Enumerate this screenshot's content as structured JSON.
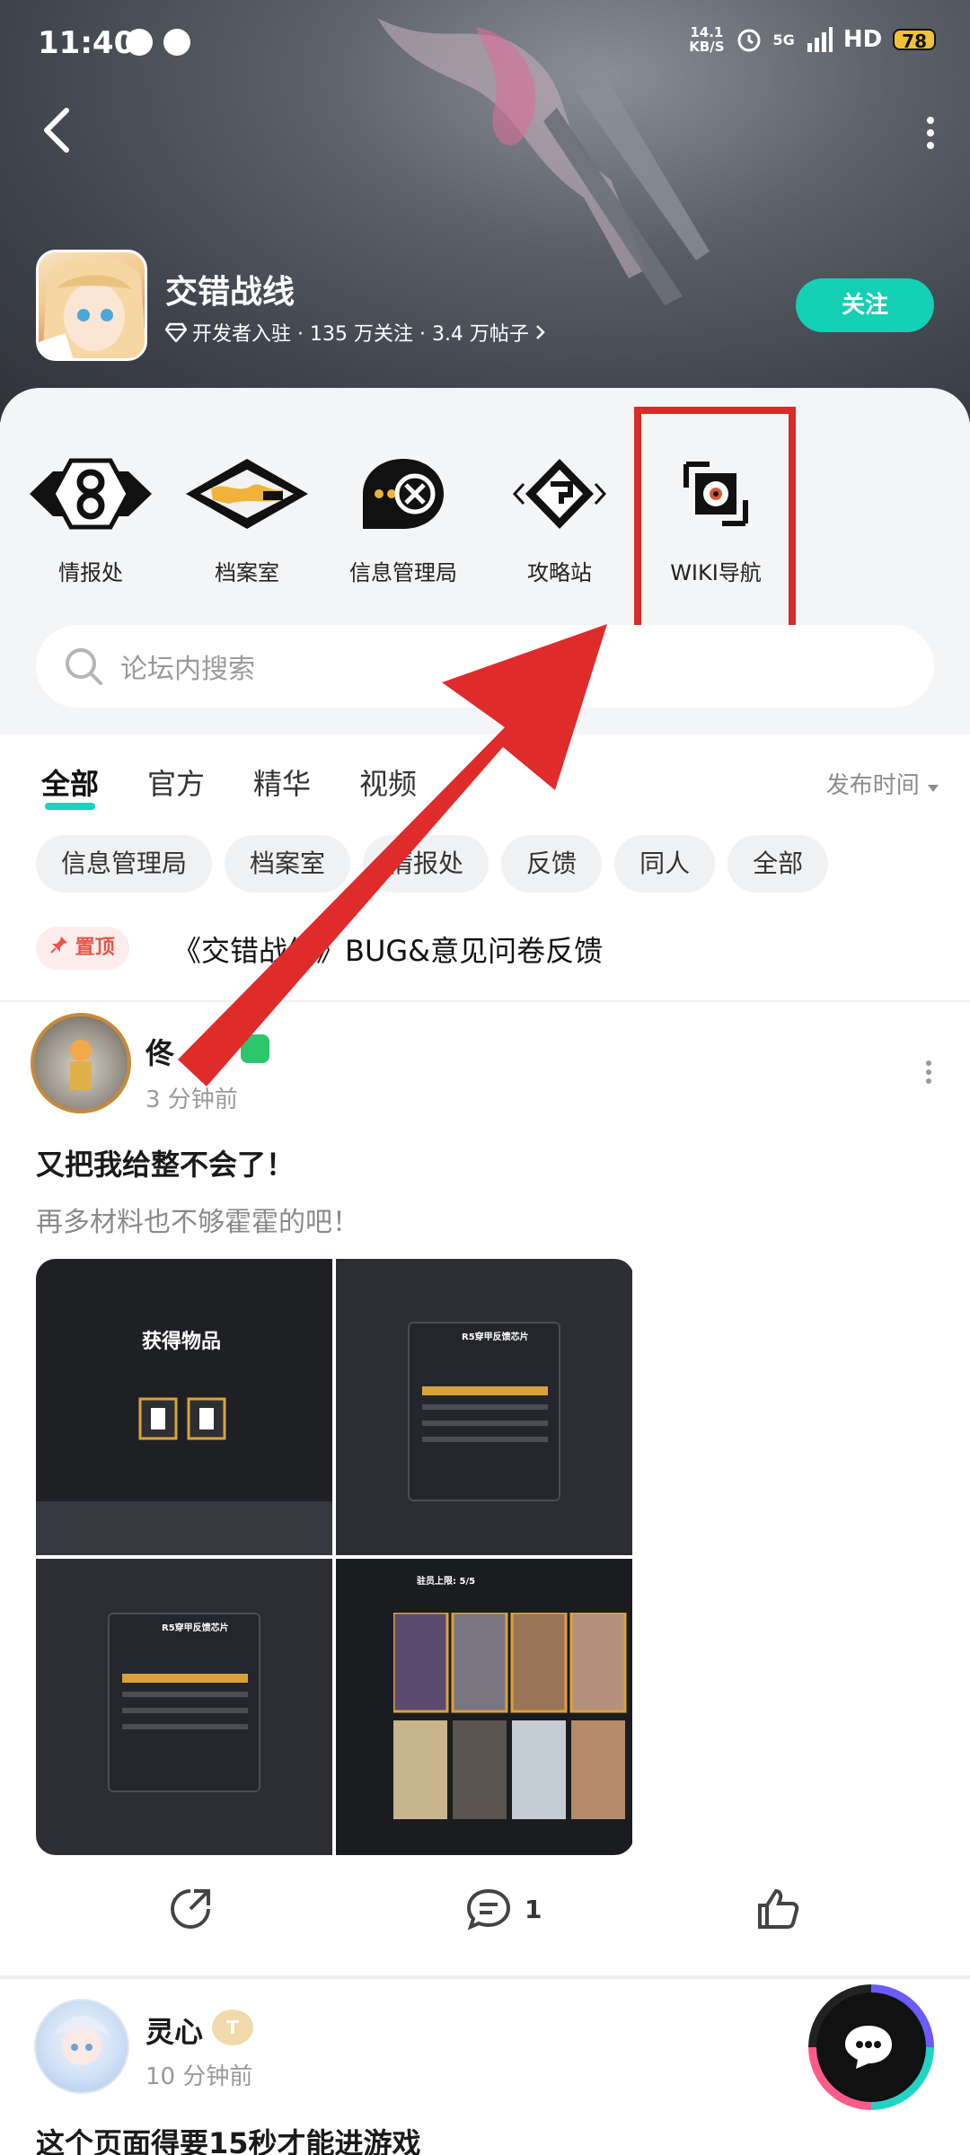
{
  "status_bar": {
    "time": "11:40",
    "net_speed_value": "14.1",
    "net_speed_unit": "KB/S",
    "network": "5G",
    "hd": "HD",
    "battery": "78"
  },
  "forum": {
    "name": "交错战线",
    "meta": "开发者入驻 · 135 万关注 · 3.4 万帖子",
    "follow_label": "关注"
  },
  "quick_links": [
    {
      "label": "情报处",
      "icon": "intel-emblem-icon"
    },
    {
      "label": "档案室",
      "icon": "archive-emblem-icon"
    },
    {
      "label": "信息管理局",
      "icon": "info-bureau-icon"
    },
    {
      "label": "攻略站",
      "icon": "guide-station-icon"
    },
    {
      "label": "WIKI导航",
      "icon": "wiki-nav-icon"
    }
  ],
  "search": {
    "placeholder": "论坛内搜索"
  },
  "tabs": [
    "全部",
    "官方",
    "精华",
    "视频"
  ],
  "sort_label": "发布时间",
  "chips": [
    "信息管理局",
    "档案室",
    "情报处",
    "反馈",
    "同人",
    "全部"
  ],
  "pinned": {
    "tag": "置顶",
    "title": "《交错战线》BUG&意见问卷反馈"
  },
  "post1": {
    "user": "佟",
    "time": "3 分钟前",
    "title": "又把我给整不会了！",
    "body": "再多材料也不够霍霍的吧！",
    "images": {
      "img1_title": "获得物品",
      "img2_title": "R5穿甲反馈芯片",
      "img3_title": "R5穿甲反馈芯片",
      "img4_title": "驻员上限: 5/5"
    },
    "comment_count": "1"
  },
  "post2": {
    "user": "灵心",
    "badge": "T",
    "time": "10 分钟前",
    "title": "这个页面得要15秒才能进游戏"
  },
  "colors": {
    "accent": "#14d0b5",
    "highlight": "#d82b2b",
    "pinned": "#e8564a"
  }
}
